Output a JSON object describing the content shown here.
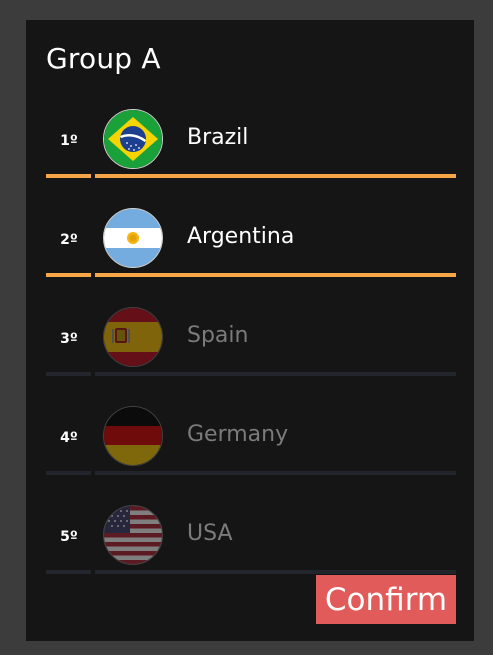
{
  "group": {
    "title": "Group A"
  },
  "teams": [
    {
      "rank": "1º",
      "name": "Brazil",
      "flag": "brazil-flag-icon",
      "selected": true
    },
    {
      "rank": "2º",
      "name": "Argentina",
      "flag": "argentina-flag-icon",
      "selected": true
    },
    {
      "rank": "3º",
      "name": "Spain",
      "flag": "spain-flag-icon",
      "selected": false
    },
    {
      "rank": "4º",
      "name": "Germany",
      "flag": "germany-flag-icon",
      "selected": false
    },
    {
      "rank": "5º",
      "name": "USA",
      "flag": "usa-flag-icon",
      "selected": false
    }
  ],
  "actions": {
    "confirm_label": "Confirm"
  },
  "colors": {
    "background": "#3c3c3c",
    "panel": "#151515",
    "accent": "#f6a646",
    "muted_bar": "#23252d",
    "confirm": "#e05b59"
  }
}
